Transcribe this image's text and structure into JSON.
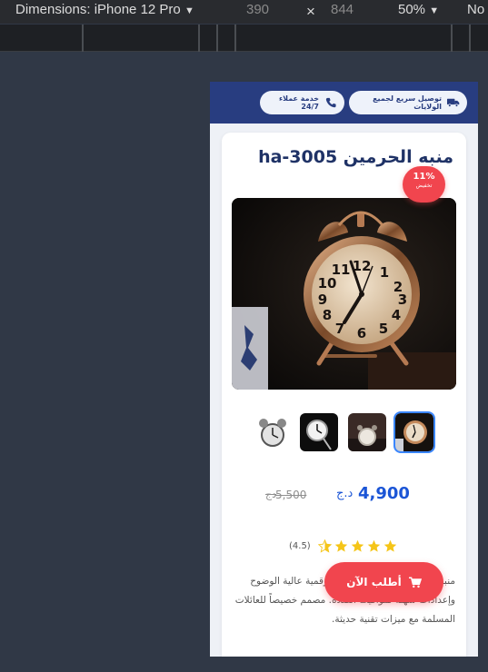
{
  "devtools": {
    "device_label": "Dimensions: iPhone 12 Pro",
    "width": "390",
    "times": "×",
    "height": "844",
    "zoom": "50%",
    "throttle": "No"
  },
  "header": {
    "delivery": "توصيل سريع لجميع الولايات",
    "support": "خدمة عملاء 24/7"
  },
  "product": {
    "title": "منبه الحرمين ha-3005",
    "discount_pct": "11%",
    "discount_label": "تخفيض",
    "price": "4,900",
    "currency": "د.ج",
    "old_price": "5,500",
    "old_currency": "دج",
    "rating_value": "(4.5)",
    "rating": 4.5,
    "description": "منبه الحرمين ha-3005 بشاشة رقمية عالية الوضوح وإعدادات سهلة لمواقيت الصلاة. مصمم خصيصاً للعائلات المسلمة مع ميزات تقنية حديثة."
  },
  "cta": {
    "order_label": "أطلب الآن"
  },
  "colors": {
    "primary": "#283d80",
    "accent": "#f1454e",
    "price": "#1b55d6",
    "star": "#f5c518"
  },
  "icons": {
    "truck": "truck-icon",
    "phone": "phone-icon",
    "cart": "cart-icon",
    "star": "star-icon"
  }
}
